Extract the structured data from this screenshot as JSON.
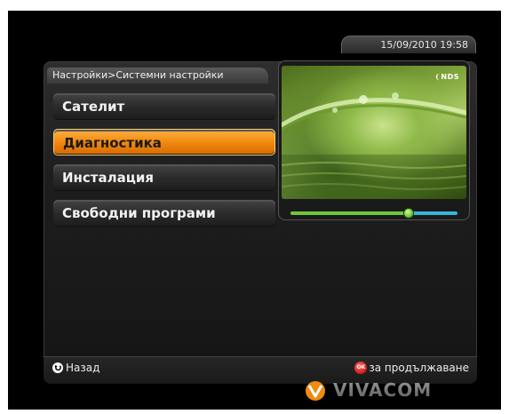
{
  "header": {
    "datetime": "15/09/2010 19:58",
    "breadcrumb": "Настройки>Системни настройки"
  },
  "menu": {
    "items": [
      {
        "label": "Сателит",
        "selected": false
      },
      {
        "label": "Диагностика",
        "selected": true
      },
      {
        "label": "Инсталация",
        "selected": false
      },
      {
        "label": "Свободни програми",
        "selected": false
      }
    ]
  },
  "preview": {
    "logo_text": "NDS",
    "slider_value": 0.7
  },
  "footer": {
    "back_label": "Назад",
    "ok_icon_text": "OK",
    "continue_label": "за продължаване"
  },
  "brand": {
    "name": "VIVACOM",
    "accent_color": "#f08a10"
  },
  "colors": {
    "selected_item": "#f08a10",
    "slider_left": "#6ec83a",
    "slider_right": "#36b6d8"
  }
}
